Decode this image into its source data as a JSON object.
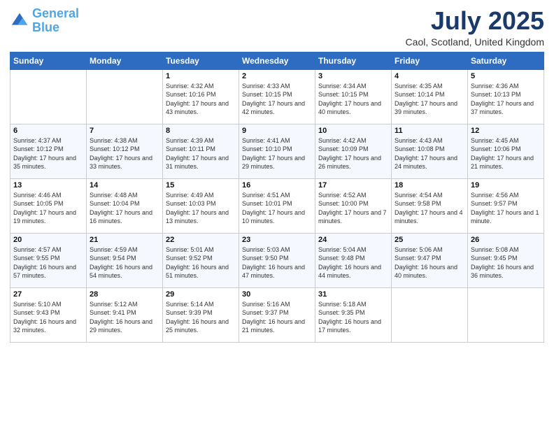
{
  "logo": {
    "line1": "General",
    "line2": "Blue"
  },
  "title": "July 2025",
  "location": "Caol, Scotland, United Kingdom",
  "weekdays": [
    "Sunday",
    "Monday",
    "Tuesday",
    "Wednesday",
    "Thursday",
    "Friday",
    "Saturday"
  ],
  "weeks": [
    [
      {
        "day": "",
        "info": ""
      },
      {
        "day": "",
        "info": ""
      },
      {
        "day": "1",
        "info": "Sunrise: 4:32 AM\nSunset: 10:16 PM\nDaylight: 17 hours and 43 minutes."
      },
      {
        "day": "2",
        "info": "Sunrise: 4:33 AM\nSunset: 10:15 PM\nDaylight: 17 hours and 42 minutes."
      },
      {
        "day": "3",
        "info": "Sunrise: 4:34 AM\nSunset: 10:15 PM\nDaylight: 17 hours and 40 minutes."
      },
      {
        "day": "4",
        "info": "Sunrise: 4:35 AM\nSunset: 10:14 PM\nDaylight: 17 hours and 39 minutes."
      },
      {
        "day": "5",
        "info": "Sunrise: 4:36 AM\nSunset: 10:13 PM\nDaylight: 17 hours and 37 minutes."
      }
    ],
    [
      {
        "day": "6",
        "info": "Sunrise: 4:37 AM\nSunset: 10:12 PM\nDaylight: 17 hours and 35 minutes."
      },
      {
        "day": "7",
        "info": "Sunrise: 4:38 AM\nSunset: 10:12 PM\nDaylight: 17 hours and 33 minutes."
      },
      {
        "day": "8",
        "info": "Sunrise: 4:39 AM\nSunset: 10:11 PM\nDaylight: 17 hours and 31 minutes."
      },
      {
        "day": "9",
        "info": "Sunrise: 4:41 AM\nSunset: 10:10 PM\nDaylight: 17 hours and 29 minutes."
      },
      {
        "day": "10",
        "info": "Sunrise: 4:42 AM\nSunset: 10:09 PM\nDaylight: 17 hours and 26 minutes."
      },
      {
        "day": "11",
        "info": "Sunrise: 4:43 AM\nSunset: 10:08 PM\nDaylight: 17 hours and 24 minutes."
      },
      {
        "day": "12",
        "info": "Sunrise: 4:45 AM\nSunset: 10:06 PM\nDaylight: 17 hours and 21 minutes."
      }
    ],
    [
      {
        "day": "13",
        "info": "Sunrise: 4:46 AM\nSunset: 10:05 PM\nDaylight: 17 hours and 19 minutes."
      },
      {
        "day": "14",
        "info": "Sunrise: 4:48 AM\nSunset: 10:04 PM\nDaylight: 17 hours and 16 minutes."
      },
      {
        "day": "15",
        "info": "Sunrise: 4:49 AM\nSunset: 10:03 PM\nDaylight: 17 hours and 13 minutes."
      },
      {
        "day": "16",
        "info": "Sunrise: 4:51 AM\nSunset: 10:01 PM\nDaylight: 17 hours and 10 minutes."
      },
      {
        "day": "17",
        "info": "Sunrise: 4:52 AM\nSunset: 10:00 PM\nDaylight: 17 hours and 7 minutes."
      },
      {
        "day": "18",
        "info": "Sunrise: 4:54 AM\nSunset: 9:58 PM\nDaylight: 17 hours and 4 minutes."
      },
      {
        "day": "19",
        "info": "Sunrise: 4:56 AM\nSunset: 9:57 PM\nDaylight: 17 hours and 1 minute."
      }
    ],
    [
      {
        "day": "20",
        "info": "Sunrise: 4:57 AM\nSunset: 9:55 PM\nDaylight: 16 hours and 57 minutes."
      },
      {
        "day": "21",
        "info": "Sunrise: 4:59 AM\nSunset: 9:54 PM\nDaylight: 16 hours and 54 minutes."
      },
      {
        "day": "22",
        "info": "Sunrise: 5:01 AM\nSunset: 9:52 PM\nDaylight: 16 hours and 51 minutes."
      },
      {
        "day": "23",
        "info": "Sunrise: 5:03 AM\nSunset: 9:50 PM\nDaylight: 16 hours and 47 minutes."
      },
      {
        "day": "24",
        "info": "Sunrise: 5:04 AM\nSunset: 9:48 PM\nDaylight: 16 hours and 44 minutes."
      },
      {
        "day": "25",
        "info": "Sunrise: 5:06 AM\nSunset: 9:47 PM\nDaylight: 16 hours and 40 minutes."
      },
      {
        "day": "26",
        "info": "Sunrise: 5:08 AM\nSunset: 9:45 PM\nDaylight: 16 hours and 36 minutes."
      }
    ],
    [
      {
        "day": "27",
        "info": "Sunrise: 5:10 AM\nSunset: 9:43 PM\nDaylight: 16 hours and 32 minutes."
      },
      {
        "day": "28",
        "info": "Sunrise: 5:12 AM\nSunset: 9:41 PM\nDaylight: 16 hours and 29 minutes."
      },
      {
        "day": "29",
        "info": "Sunrise: 5:14 AM\nSunset: 9:39 PM\nDaylight: 16 hours and 25 minutes."
      },
      {
        "day": "30",
        "info": "Sunrise: 5:16 AM\nSunset: 9:37 PM\nDaylight: 16 hours and 21 minutes."
      },
      {
        "day": "31",
        "info": "Sunrise: 5:18 AM\nSunset: 9:35 PM\nDaylight: 16 hours and 17 minutes."
      },
      {
        "day": "",
        "info": ""
      },
      {
        "day": "",
        "info": ""
      }
    ]
  ]
}
